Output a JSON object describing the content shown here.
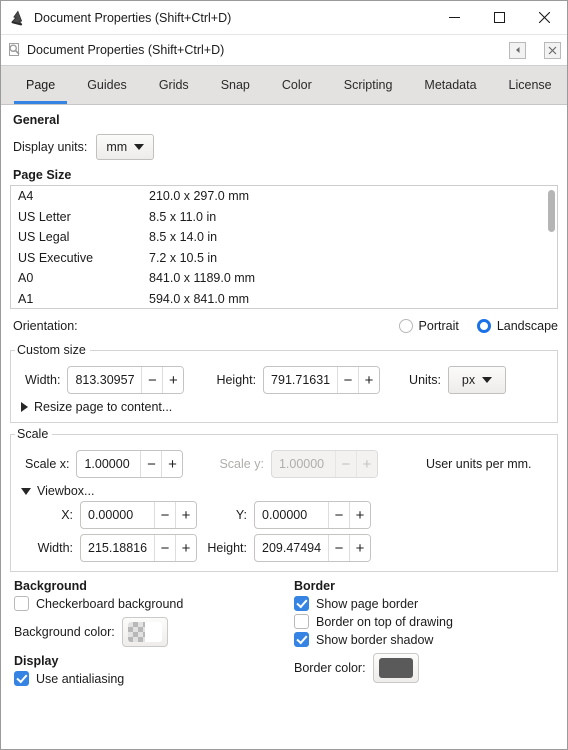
{
  "window": {
    "title": "Document Properties (Shift+Ctrl+D)",
    "app_icon": "inkscape-logo-icon",
    "minimize_label": "─",
    "maximize_label": "☐",
    "close_label": "✕"
  },
  "dock": {
    "icon": "document-properties-icon",
    "title": "Document Properties (Shift+Ctrl+D)",
    "float_label": "◂",
    "close_label": "✕"
  },
  "tabs": [
    {
      "label": "Page",
      "active": true
    },
    {
      "label": "Guides",
      "active": false
    },
    {
      "label": "Grids",
      "active": false
    },
    {
      "label": "Snap",
      "active": false
    },
    {
      "label": "Color",
      "active": false
    },
    {
      "label": "Scripting",
      "active": false
    },
    {
      "label": "Metadata",
      "active": false
    },
    {
      "label": "License",
      "active": false
    }
  ],
  "general": {
    "heading": "General",
    "display_units_label": "Display units:",
    "display_units_value": "mm"
  },
  "page_size": {
    "heading": "Page Size",
    "rows": [
      {
        "name": "A4",
        "dims": "210.0 x 297.0 mm"
      },
      {
        "name": "US Letter",
        "dims": "8.5 x 11.0 in"
      },
      {
        "name": "US Legal",
        "dims": "8.5 x 14.0 in"
      },
      {
        "name": "US Executive",
        "dims": "7.2 x 10.5 in"
      },
      {
        "name": "A0",
        "dims": "841.0 x 1189.0 mm"
      },
      {
        "name": "A1",
        "dims": "594.0 x 841.0 mm"
      }
    ]
  },
  "orientation": {
    "label": "Orientation:",
    "portrait_label": "Portrait",
    "landscape_label": "Landscape",
    "selected": "Landscape"
  },
  "custom_size": {
    "legend": "Custom size",
    "width_label": "Width:",
    "width_value": "813.30957",
    "height_label": "Height:",
    "height_value": "791.71631",
    "units_label": "Units:",
    "units_value": "px",
    "resize_to_content_label": "Resize page to content..."
  },
  "scale": {
    "legend": "Scale",
    "scale_x_label": "Scale x:",
    "scale_x_value": "1.00000",
    "scale_y_label": "Scale y:",
    "scale_y_value": "1.00000",
    "scale_y_disabled": true,
    "user_units_label": "User units per mm.",
    "viewbox_label": "Viewbox...",
    "viewbox_expanded": true,
    "x_label": "X:",
    "x_value": "0.00000",
    "y_label": "Y:",
    "y_value": "0.00000",
    "vb_width_label": "Width:",
    "vb_width_value": "215.18816",
    "vb_height_label": "Height:",
    "vb_height_value": "209.47494"
  },
  "background": {
    "heading": "Background",
    "checkerboard_label": "Checkerboard background",
    "checkerboard_checked": false,
    "color_label": "Background color:",
    "color_value": "#ffffff"
  },
  "display": {
    "heading": "Display",
    "antialias_label": "Use antialiasing",
    "antialias_checked": true
  },
  "border": {
    "heading": "Border",
    "show_page_border_label": "Show page border",
    "show_page_border_checked": true,
    "border_on_top_label": "Border on top of drawing",
    "border_on_top_checked": false,
    "show_shadow_label": "Show border shadow",
    "show_shadow_checked": true,
    "color_label": "Border color:",
    "color_value": "#5a5a5a"
  },
  "spin_buttons": {
    "minus": "−",
    "plus": "+"
  },
  "colors": {
    "accent": "#3584e4",
    "radio_accent": "#1b72e8",
    "tab_strip_bg": "#e4e2e0"
  }
}
